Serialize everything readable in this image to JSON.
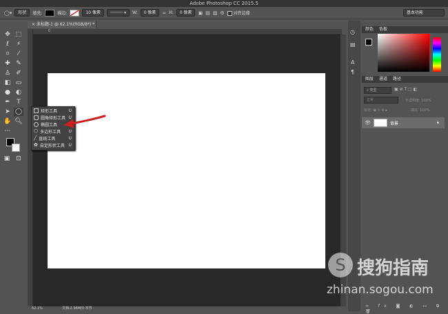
{
  "app": {
    "title": "Adobe Photoshop CC 2015.5"
  },
  "options_bar": {
    "mode": "形状",
    "fill_label": "填充:",
    "stroke_label": "描边:",
    "stroke_size": "10 像素",
    "w_label": "W:",
    "w_value": "0 像素",
    "h_label": "H:",
    "h_value": "0 像素",
    "align_edges": "对齐边缘",
    "workspace": "基本功能"
  },
  "document": {
    "tab_label": "未标题-1 @ 62.1%(RGB/8*) *",
    "ruler_origin": "0"
  },
  "status": {
    "zoom": "62.1%",
    "doc_info": "文档:2.96M/0 字节"
  },
  "flyout": {
    "items": [
      {
        "label": "矩形工具",
        "key": "U"
      },
      {
        "label": "圆角矩形工具",
        "key": "U"
      },
      {
        "label": "椭圆工具",
        "key": "U"
      },
      {
        "label": "多边形工具",
        "key": "U"
      },
      {
        "label": "直线工具",
        "key": "U"
      },
      {
        "label": "自定形状工具",
        "key": "U"
      }
    ]
  },
  "panels": {
    "color_tabs": [
      "颜色",
      "色板"
    ],
    "layers_tabs": [
      "图层",
      "通道",
      "路径"
    ],
    "layer_search": "类型",
    "blend_mode": "正常",
    "opacity_label": "不透明度:",
    "opacity_value": "100%",
    "lock_label": "锁定:",
    "fill_label": "填充:",
    "fill_value": "100%",
    "layer_name": "背景"
  },
  "watermark": {
    "brand": "搜狗指南",
    "url": "zhinan.sogou.com"
  },
  "colors": {
    "accent_arrow": "#cc1f1f",
    "fill_swatch": "#000000"
  },
  "icons": {
    "toolbar": [
      "move-icon",
      "marquee-icon",
      "lasso-icon",
      "magic-wand-icon",
      "crop-icon",
      "eyedropper-icon",
      "healing-brush-icon",
      "brush-icon",
      "stamp-icon",
      "history-brush-icon",
      "eraser-icon",
      "gradient-icon",
      "blur-icon",
      "dodge-icon",
      "pen-icon",
      "type-icon",
      "path-select-icon",
      "ellipse-icon",
      "hand-icon",
      "zoom-icon"
    ]
  }
}
